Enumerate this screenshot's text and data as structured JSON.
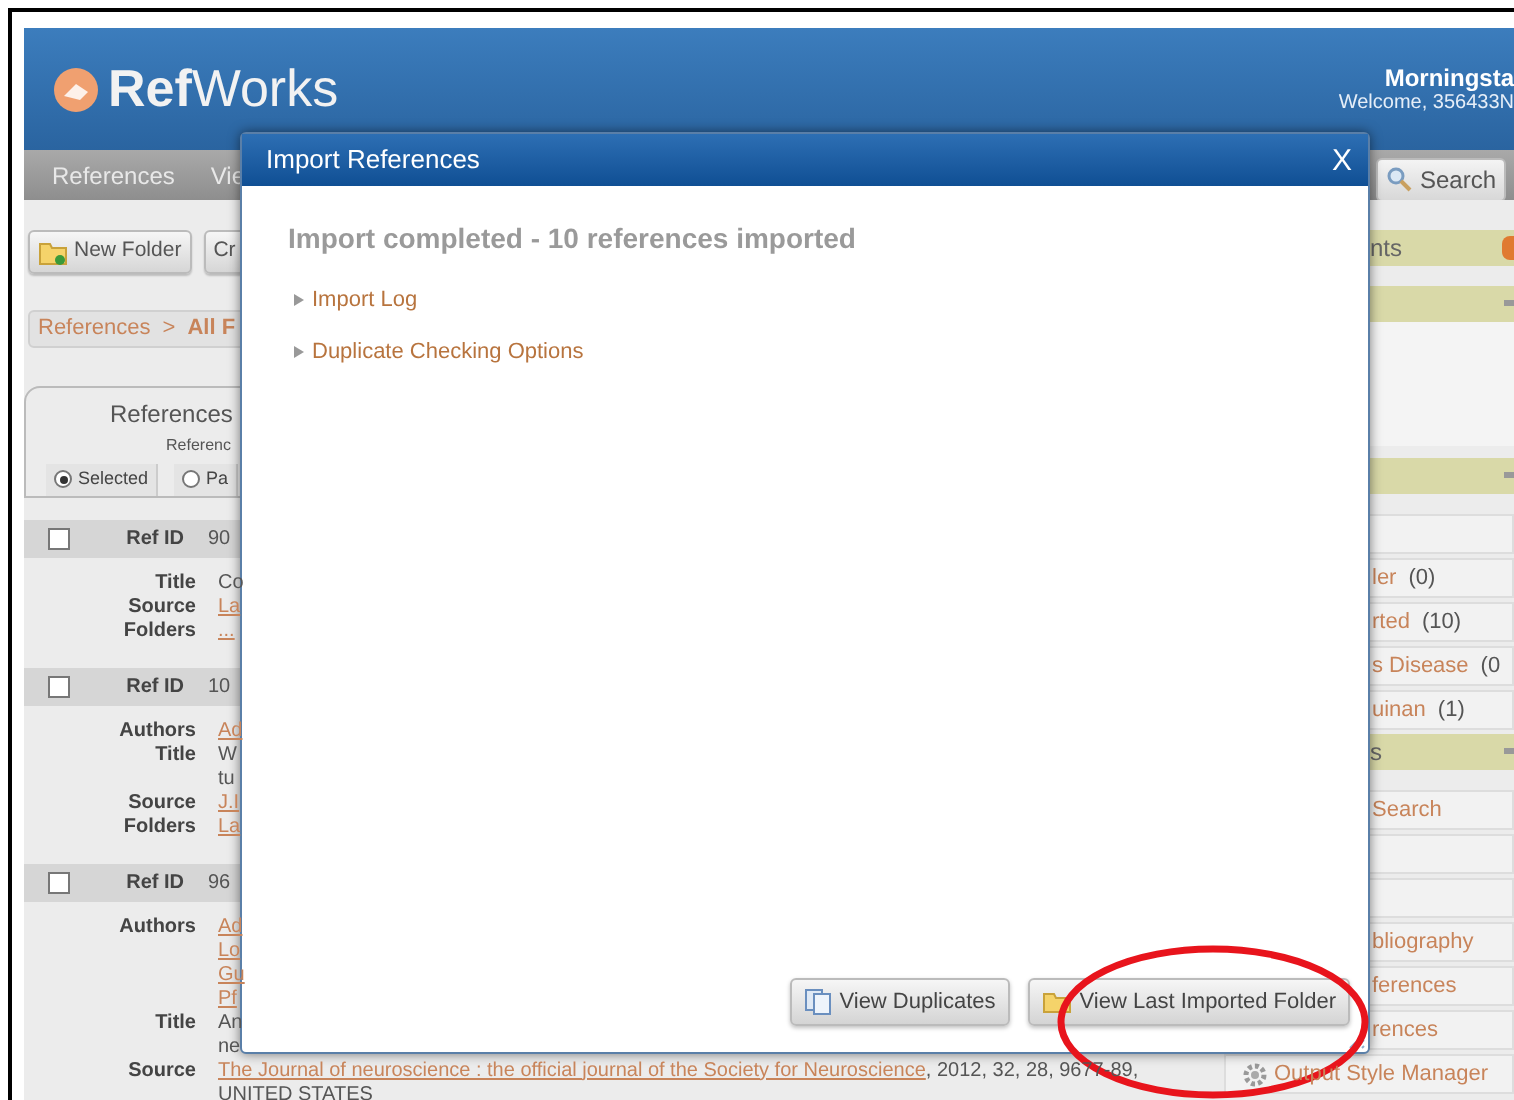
{
  "header": {
    "logo": "**Ref**Works",
    "user_name": "Morningsta",
    "welcome": "Welcome, 356433N"
  },
  "nav": {
    "items": [
      {
        "label": "References"
      },
      {
        "label": "Vie"
      }
    ],
    "search_button": "Search"
  },
  "toolbar": {
    "buttons": [
      {
        "label": "New Folder",
        "kind": "folder"
      },
      {
        "label": "Cr",
        "kind": "plain"
      }
    ]
  },
  "breadcrumb": {
    "root": "References",
    "separator": ">",
    "current": "All F"
  },
  "references_panel": {
    "title": "References",
    "subtitle": "Referenc",
    "options": [
      {
        "label": "Selected",
        "selected": true
      },
      {
        "label": "Pa",
        "selected": false
      }
    ]
  },
  "records": [
    {
      "ref_id_label": "Ref ID",
      "ref_id": "90",
      "checked": false,
      "fields": [
        {
          "label": "Title",
          "lines": [
            [
              {
                "text": "Co",
                "link": false
              }
            ]
          ]
        },
        {
          "label": "Source",
          "lines": [
            [
              {
                "text": "La",
                "link": true
              }
            ]
          ]
        },
        {
          "label": "Folders",
          "lines": [
            [
              {
                "text": "...",
                "link": true
              }
            ]
          ]
        }
      ]
    },
    {
      "ref_id_label": "Ref ID",
      "ref_id": "10",
      "checked": false,
      "fields": [
        {
          "label": "Authors",
          "lines": [
            [
              {
                "text": "Ad",
                "link": true
              }
            ]
          ]
        },
        {
          "label": "Title",
          "lines": [
            [
              {
                "text": "W",
                "link": false
              }
            ],
            [
              {
                "text": "tu",
                "link": false
              }
            ]
          ]
        },
        {
          "label": "Source",
          "lines": [
            [
              {
                "text": "J.I",
                "link": true
              }
            ]
          ]
        },
        {
          "label": "Folders",
          "lines": [
            [
              {
                "text": "La",
                "link": true
              }
            ]
          ]
        }
      ]
    },
    {
      "ref_id_label": "Ref ID",
      "ref_id": "96",
      "checked": false,
      "fields": [
        {
          "label": "Authors",
          "lines": [
            [
              {
                "text": "Ad",
                "link": true
              }
            ],
            [
              {
                "text": "Lo",
                "link": true
              }
            ],
            [
              {
                "text": "Gu",
                "link": true
              }
            ],
            [
              {
                "text": "Pf",
                "link": true
              }
            ]
          ]
        },
        {
          "label": "Title",
          "lines": [
            [
              {
                "text": "An",
                "link": false
              }
            ],
            [
              {
                "text": "ne",
                "link": false
              }
            ]
          ]
        },
        {
          "label": "Source",
          "lines": [
            [
              {
                "text": "The Journal of neuroscience : the official journal of the Society for Neuroscience",
                "link": true
              },
              {
                "text": ", 2012, 32, 28, 9677-89,",
                "link": false
              }
            ],
            [
              {
                "text": "UNITED STATES",
                "link": false
              }
            ]
          ]
        }
      ]
    }
  ],
  "sidebar": [
    {
      "kind": "bar",
      "title": "nts",
      "badge": true,
      "collapse": false
    },
    {
      "kind": "bar",
      "collapse": true
    },
    {
      "kind": "pane"
    },
    {
      "kind": "bar",
      "collapse": true
    },
    {
      "kind": "blank"
    },
    {
      "kind": "item",
      "label": "ler",
      "count": "(0)"
    },
    {
      "kind": "item",
      "label": "rted",
      "count": "(10)"
    },
    {
      "kind": "item",
      "label": "s Disease",
      "count": "(0"
    },
    {
      "kind": "item",
      "label": "uinan",
      "count": "(1)"
    },
    {
      "kind": "bar",
      "title": "s",
      "collapse": true
    },
    {
      "kind": "item",
      "label": "Search"
    },
    {
      "kind": "blank"
    },
    {
      "kind": "blank"
    },
    {
      "kind": "item",
      "label": "bliography"
    },
    {
      "kind": "item",
      "label": "ferences"
    },
    {
      "kind": "item",
      "label": "rences"
    },
    {
      "kind": "tool",
      "label": "Output Style Manager"
    }
  ],
  "dialog": {
    "title": "Import References",
    "close": "X",
    "heading": "Import completed - 10 references imported",
    "sections": [
      {
        "label": "Import Log",
        "expanded": false
      },
      {
        "label": "Duplicate Checking Options",
        "expanded": false
      }
    ],
    "buttons": [
      {
        "label": "View Duplicates",
        "kind": "duplicates"
      },
      {
        "label": "View Last Imported Folder",
        "kind": "folder"
      }
    ]
  }
}
